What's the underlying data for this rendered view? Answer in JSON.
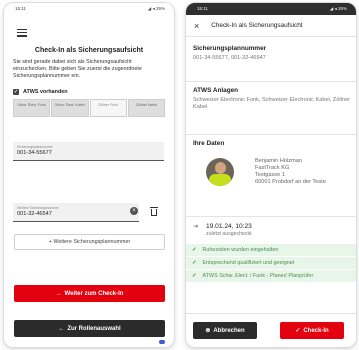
{
  "left": {
    "status_time": "15:11",
    "status_right": "◢ ◂ 26%",
    "title": "Check-In als Sicherungsaufsicht",
    "description": "Sie sind gerade dabei sich als Sicherungsaufsicht einzuchecken. Bitte geben Sie zuerst die zugeordnete Sicherungsplannummer ein.",
    "atws_label": "ATWS vorhanden",
    "chips": [
      "Schw. Elect. Funk",
      "Schw. Elect. Kabel",
      "Zöllner Funk",
      "Zöllner Kabel"
    ],
    "chip_active_index": 2,
    "field1": {
      "label": "Sicherungsplannummer",
      "value": "001-34-55677"
    },
    "field2": {
      "label": "Weitere Sicherungsnummer",
      "value": "001-32-46547"
    },
    "add_button": "+ Weitere Sicherungsplannummer",
    "next_button": "Weiter zum Check-In",
    "back_button": "Zur Rollenauswahl"
  },
  "right": {
    "status_time": "15:11",
    "status_right": "◢ ◂ 26%",
    "header_title": "Check-In als Sicherungsaufsicht",
    "plan_heading": "Sicherungsplannummer",
    "plan_values": "001-34-55677, 001-32-46547",
    "atws_heading": "ATWS Anlagen",
    "atws_values": "Schweizer Electronic Funk, Schweizer Electronic Kabel, Zöllner Kabel",
    "data_heading": "Ihre Daten",
    "person": {
      "name": "Benjamin Holzman",
      "company": "FastTrack KG",
      "street": "Testgasse 1",
      "city": "60001 Probdorf an der Teste"
    },
    "timestamp": "19.01.24, 10:23",
    "timestamp_sub": "zuletzt ausgecheckt",
    "checks": [
      "Ruhezeiten wurden eingehalten",
      "Entsprechend qualifiziert und geeignet",
      "ATWS Schw. Elect. / Funk - Planer/ Planprüfer"
    ],
    "cancel_button": "Abbrechen",
    "checkin_button": "Check-In"
  }
}
